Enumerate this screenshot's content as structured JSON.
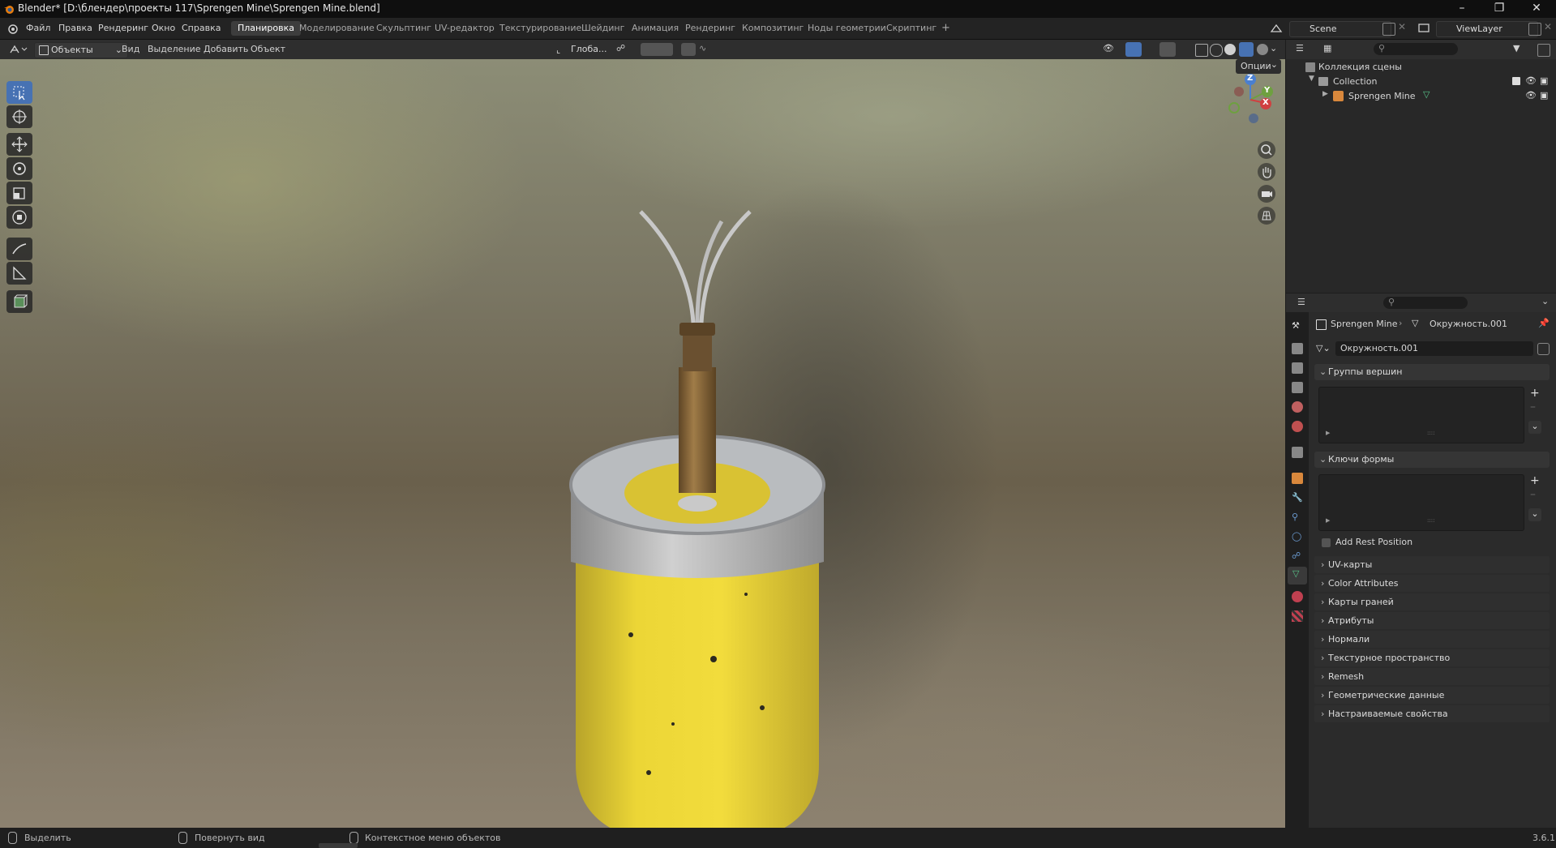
{
  "window": {
    "title": "Blender* [D:\\блендер\\проекты 117\\Sprengen Mine\\Sprengen Mine.blend]",
    "controls": [
      "minimize-icon",
      "restore-icon",
      "close-icon"
    ]
  },
  "topbar": {
    "menus": [
      "Файл",
      "Правка",
      "Рендеринг",
      "Окно",
      "Справка"
    ],
    "workspaces": [
      "Планировка",
      "Моделирование",
      "Скульптинг",
      "UV-редактор",
      "Текстурирование",
      "Шейдинг",
      "Анимация",
      "Рендеринг",
      "Композитинг",
      "Ноды геометрии",
      "Скриптинг"
    ],
    "active_workspace": "Планировка",
    "add_tab": "+",
    "scene": "Scene",
    "view_layer": "ViewLayer"
  },
  "viewport_header": {
    "mode": "Объекты",
    "menus": [
      "Вид",
      "Выделение",
      "Добавить",
      "Объект"
    ],
    "transform_orientation": "Глоба...",
    "options": "Опции"
  },
  "toolbar": {
    "tools": [
      "select-box-icon",
      "cursor-icon",
      "move-icon",
      "rotate-icon",
      "scale-icon",
      "transform-icon",
      "annotate-icon",
      "measure-icon",
      "add-cube-icon"
    ],
    "active_tool": "select-box-icon"
  },
  "gizmo": {
    "axes": [
      "Z",
      "Y",
      "X"
    ]
  },
  "outliner": {
    "root": "Коллекция сцены",
    "collection": "Collection",
    "object": "Sprengen Mine"
  },
  "properties": {
    "breadcrumb_object": "Sprengen Mine",
    "breadcrumb_data": "Окружность.001",
    "mesh_name": "Окружность.001",
    "vertex_groups": "Группы вершин",
    "shape_keys": "Ключи формы",
    "add_rest_position": "Add Rest Position",
    "sections": [
      "UV-карты",
      "Color Attributes",
      "Карты граней",
      "Атрибуты",
      "Нормали",
      "Текстурное пространство",
      "Remesh",
      "Геометрические данные",
      "Настраиваемые свойства"
    ]
  },
  "statusbar": {
    "select": "Выделить",
    "rotate_view": "Повернуть вид",
    "context_menu": "Контекстное меню объектов",
    "version": "3.6.1"
  },
  "colors": {
    "accent": "#4772b3",
    "mine_yellow": "#e9d330",
    "mine_silver": "#b8b8b8",
    "brass": "#8a6a3a"
  }
}
